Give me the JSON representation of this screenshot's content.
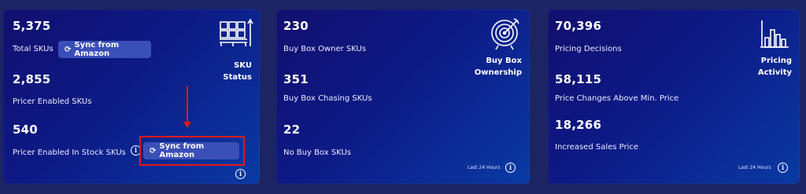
{
  "sku_status": {
    "title": "SKU\nStatus",
    "total_skus": "5,375",
    "total_skus_label": "Total SKUs",
    "sync_label": "Sync from Amazon",
    "pricer_enabled": "2,855",
    "pricer_enabled_label": "Pricer Enabled SKUs",
    "pricer_in_stock": "540",
    "pricer_in_stock_label": "Pricer Enabled In Stock SKUs",
    "sync_label_2": "Sync from Amazon"
  },
  "buy_box": {
    "title": "Buy Box\nOwnership",
    "owner": "230",
    "owner_label": "Buy Box Owner SKUs",
    "chasing": "351",
    "chasing_label": "Buy Box Chasing SKUs",
    "none": "22",
    "none_label": "No Buy Box SKUs",
    "period": "Last 24 Hours"
  },
  "pricing": {
    "title": "Pricing\nActivity",
    "decisions": "70,396",
    "decisions_label": "Pricing Decisions",
    "above_min": "58,115",
    "above_min_label": "Price Changes Above Min. Price",
    "increased": "18,266",
    "increased_label": "Increased Sales Price",
    "period": "Last 24 Hours"
  },
  "icons": {
    "info": "info-icon",
    "sync": "sync-icon",
    "warehouse": "warehouse-icon",
    "target": "target-icon",
    "bar_chart": "bar-chart-icon"
  },
  "colors": {
    "background": "#1c2463",
    "card_gradient_start": "#120f6e",
    "card_gradient_end": "#0a3aa3",
    "button": "#3a4fb8",
    "highlight": "#e01818"
  }
}
